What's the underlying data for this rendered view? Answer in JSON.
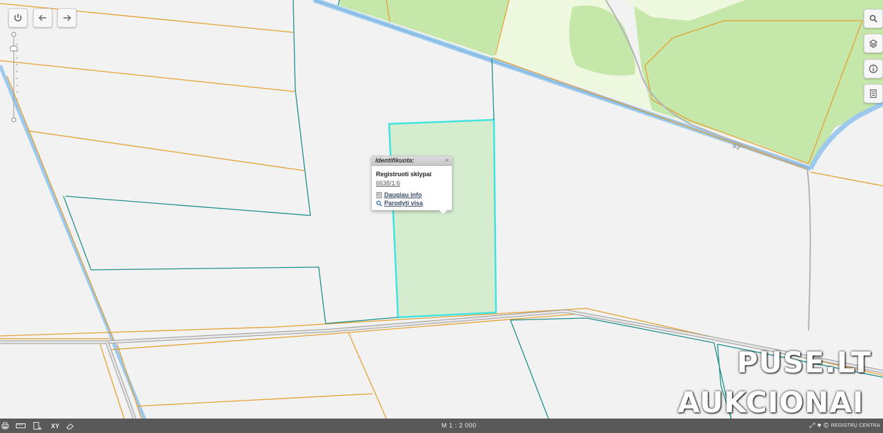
{
  "toolbar": {
    "buttons": [
      {
        "name": "power-icon"
      },
      {
        "name": "arrow-left-icon"
      },
      {
        "name": "arrow-right-icon"
      }
    ]
  },
  "right_toolbar": {
    "buttons": [
      {
        "name": "search-icon"
      },
      {
        "name": "layers-icon"
      },
      {
        "name": "info-icon"
      },
      {
        "name": "legend-icon"
      }
    ]
  },
  "map": {
    "road_label": "0-2",
    "colors": {
      "background": "#f2f2f2",
      "forest": "#c5e7a9",
      "meadow": "#eef8de",
      "parcel_line": "#e5a030",
      "teal_line": "#1d8f8a",
      "water": "#9cc9ec",
      "highlight_fill": "#d5ecce",
      "highlight_stroke": "#3fe3e0"
    }
  },
  "popup": {
    "title": "Identifikuota:",
    "close": "×",
    "layer_name": "Registruoti sklypai",
    "parcel_id": "6638/1:6",
    "links": [
      {
        "label": "Daugiau info",
        "icon": "document-icon"
      },
      {
        "label": "Parodyti visa",
        "icon": "magnifier-icon"
      }
    ]
  },
  "status_bar": {
    "scale": "M 1 : 2 000",
    "logo_text": "REGISTRŲ CENTRA"
  },
  "watermark": {
    "line1": "PUSE.LT",
    "line2": "AUKCIONAI"
  }
}
